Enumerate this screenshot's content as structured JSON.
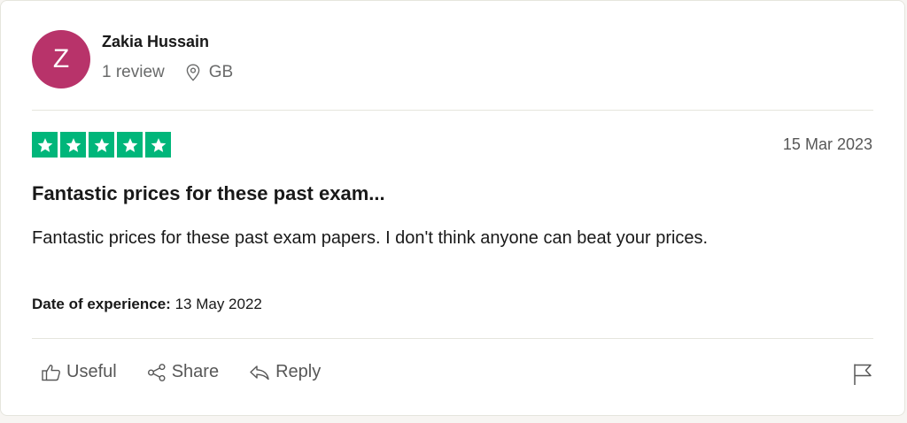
{
  "reviewer": {
    "initial": "Z",
    "name": "Zakia Hussain",
    "review_count": "1 review",
    "country": "GB",
    "avatar_color": "#b8336a"
  },
  "review": {
    "rating": 5,
    "max_rating": 5,
    "star_color": "#00b67a",
    "date": "15 Mar 2023",
    "title": "Fantastic prices for these past exam...",
    "text": "Fantastic prices for these past exam papers. I don't think anyone can beat your prices.",
    "experience_label": "Date of experience:",
    "experience_date": "13 May 2022"
  },
  "actions": {
    "useful_label": "Useful",
    "share_label": "Share",
    "reply_label": "Reply"
  },
  "icons": [
    "location-pin-icon",
    "thumbs-up-icon",
    "share-icon",
    "reply-icon",
    "flag-icon",
    "star-icon"
  ]
}
